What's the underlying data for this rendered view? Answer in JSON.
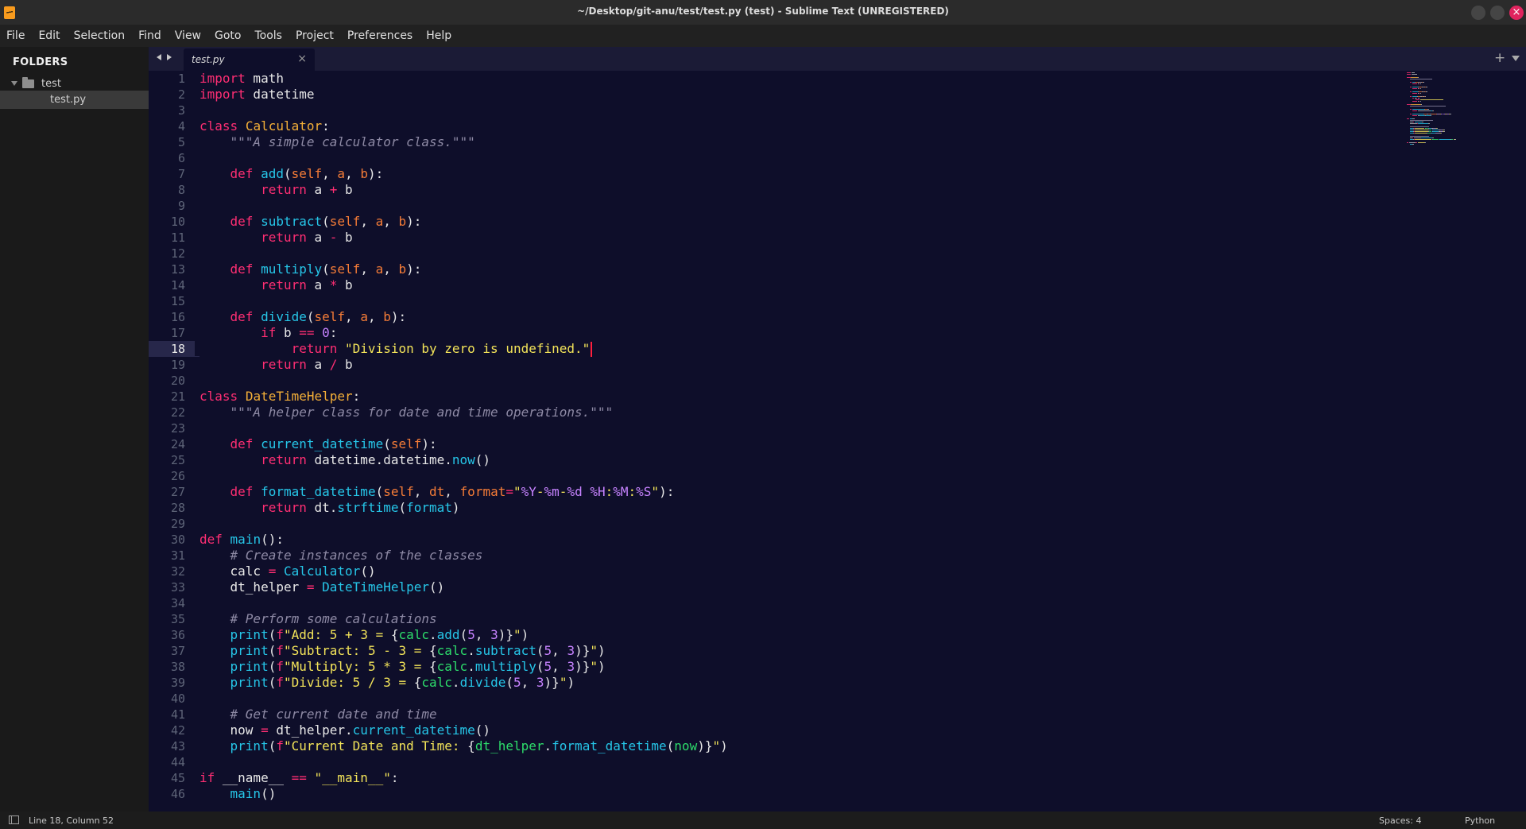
{
  "window": {
    "title": "~/Desktop/git-anu/test/test.py (test) - Sublime Text (UNREGISTERED)",
    "close_glyph": "×"
  },
  "menu": [
    "File",
    "Edit",
    "Selection",
    "Find",
    "View",
    "Goto",
    "Tools",
    "Project",
    "Preferences",
    "Help"
  ],
  "sidebar": {
    "header": "FOLDERS",
    "folder": "test",
    "file": "test.py"
  },
  "tabs": {
    "active_label": "test.py",
    "close_glyph": "×",
    "new_tab_glyph": "+"
  },
  "editor": {
    "line_numbers": [
      "1",
      "2",
      "3",
      "4",
      "5",
      "6",
      "7",
      "8",
      "9",
      "10",
      "11",
      "12",
      "13",
      "14",
      "15",
      "16",
      "17",
      "18",
      "19",
      "20",
      "21",
      "22",
      "23",
      "24",
      "25",
      "26",
      "27",
      "28",
      "29",
      "30",
      "31",
      "32",
      "33",
      "34",
      "35",
      "36",
      "37",
      "38",
      "39",
      "40",
      "41",
      "42",
      "43",
      "44",
      "45",
      "46"
    ],
    "current_line": 18,
    "colors": {
      "background": "#0e0e2a",
      "keyword": "#ff2e73",
      "class_name": "#f5b038",
      "function": "#26c6e8",
      "parameter": "#f57c37",
      "string": "#f2e359",
      "comment": "#8e8aa5",
      "format_spec": "#c783ff",
      "interpolated": "#2ddc6b",
      "cursor": "#ff1f3d"
    },
    "code_lines": [
      [
        [
          "k",
          "import"
        ],
        [
          "t",
          " math"
        ]
      ],
      [
        [
          "k",
          "import"
        ],
        [
          "t",
          " datetime"
        ]
      ],
      [],
      [
        [
          "k",
          "class"
        ],
        [
          "t",
          " "
        ],
        [
          "c",
          "Calculator"
        ],
        [
          "t",
          ":"
        ]
      ],
      [
        [
          "t",
          "    "
        ],
        [
          "cm",
          "\"\"\"A simple calculator class.\"\"\""
        ]
      ],
      [],
      [
        [
          "t",
          "    "
        ],
        [
          "k",
          "def"
        ],
        [
          "t",
          " "
        ],
        [
          "f",
          "add"
        ],
        [
          "t",
          "("
        ],
        [
          "p",
          "self"
        ],
        [
          "t",
          ", "
        ],
        [
          "p",
          "a"
        ],
        [
          "t",
          ", "
        ],
        [
          "p",
          "b"
        ],
        [
          "t",
          "):"
        ]
      ],
      [
        [
          "t",
          "        "
        ],
        [
          "k",
          "return"
        ],
        [
          "t",
          " a "
        ],
        [
          "o",
          "+"
        ],
        [
          "t",
          " b"
        ]
      ],
      [],
      [
        [
          "t",
          "    "
        ],
        [
          "k",
          "def"
        ],
        [
          "t",
          " "
        ],
        [
          "f",
          "subtract"
        ],
        [
          "t",
          "("
        ],
        [
          "p",
          "self"
        ],
        [
          "t",
          ", "
        ],
        [
          "p",
          "a"
        ],
        [
          "t",
          ", "
        ],
        [
          "p",
          "b"
        ],
        [
          "t",
          "):"
        ]
      ],
      [
        [
          "t",
          "        "
        ],
        [
          "k",
          "return"
        ],
        [
          "t",
          " a "
        ],
        [
          "o",
          "-"
        ],
        [
          "t",
          " b"
        ]
      ],
      [],
      [
        [
          "t",
          "    "
        ],
        [
          "k",
          "def"
        ],
        [
          "t",
          " "
        ],
        [
          "f",
          "multiply"
        ],
        [
          "t",
          "("
        ],
        [
          "p",
          "self"
        ],
        [
          "t",
          ", "
        ],
        [
          "p",
          "a"
        ],
        [
          "t",
          ", "
        ],
        [
          "p",
          "b"
        ],
        [
          "t",
          "):"
        ]
      ],
      [
        [
          "t",
          "        "
        ],
        [
          "k",
          "return"
        ],
        [
          "t",
          " a "
        ],
        [
          "o",
          "*"
        ],
        [
          "t",
          " b"
        ]
      ],
      [],
      [
        [
          "t",
          "    "
        ],
        [
          "k",
          "def"
        ],
        [
          "t",
          " "
        ],
        [
          "f",
          "divide"
        ],
        [
          "t",
          "("
        ],
        [
          "p",
          "self"
        ],
        [
          "t",
          ", "
        ],
        [
          "p",
          "a"
        ],
        [
          "t",
          ", "
        ],
        [
          "p",
          "b"
        ],
        [
          "t",
          "):"
        ]
      ],
      [
        [
          "t",
          "        "
        ],
        [
          "k",
          "if"
        ],
        [
          "t",
          " b "
        ],
        [
          "o",
          "=="
        ],
        [
          "t",
          " "
        ],
        [
          "n",
          "0"
        ],
        [
          "t",
          ":"
        ]
      ],
      [
        [
          "t",
          "            "
        ],
        [
          "k",
          "return"
        ],
        [
          "t",
          " "
        ],
        [
          "s",
          "\"Division by zero is undefined.\""
        ],
        [
          "cursor",
          ""
        ]
      ],
      [
        [
          "t",
          "        "
        ],
        [
          "k",
          "return"
        ],
        [
          "t",
          " a "
        ],
        [
          "o",
          "/"
        ],
        [
          "t",
          " b"
        ]
      ],
      [],
      [
        [
          "k",
          "class"
        ],
        [
          "t",
          " "
        ],
        [
          "c",
          "DateTimeHelper"
        ],
        [
          "t",
          ":"
        ]
      ],
      [
        [
          "t",
          "    "
        ],
        [
          "cm",
          "\"\"\"A helper class for date and time operations.\"\"\""
        ]
      ],
      [],
      [
        [
          "t",
          "    "
        ],
        [
          "k",
          "def"
        ],
        [
          "t",
          " "
        ],
        [
          "f",
          "current_datetime"
        ],
        [
          "t",
          "("
        ],
        [
          "p",
          "self"
        ],
        [
          "t",
          "):"
        ]
      ],
      [
        [
          "t",
          "        "
        ],
        [
          "k",
          "return"
        ],
        [
          "t",
          " datetime.datetime."
        ],
        [
          "f",
          "now"
        ],
        [
          "t",
          "()"
        ]
      ],
      [],
      [
        [
          "t",
          "    "
        ],
        [
          "k",
          "def"
        ],
        [
          "t",
          " "
        ],
        [
          "f",
          "format_datetime"
        ],
        [
          "t",
          "("
        ],
        [
          "p",
          "self"
        ],
        [
          "t",
          ", "
        ],
        [
          "p",
          "dt"
        ],
        [
          "t",
          ", "
        ],
        [
          "p",
          "format"
        ],
        [
          "o",
          "="
        ],
        [
          "s",
          "\""
        ],
        [
          "n",
          "%Y"
        ],
        [
          "s",
          "-"
        ],
        [
          "n",
          "%m"
        ],
        [
          "s",
          "-"
        ],
        [
          "n",
          "%d"
        ],
        [
          "s",
          " "
        ],
        [
          "n",
          "%H"
        ],
        [
          "s",
          ":"
        ],
        [
          "n",
          "%M"
        ],
        [
          "s",
          ":"
        ],
        [
          "n",
          "%S"
        ],
        [
          "s",
          "\""
        ],
        [
          "t",
          "):"
        ]
      ],
      [
        [
          "t",
          "        "
        ],
        [
          "k",
          "return"
        ],
        [
          "t",
          " dt."
        ],
        [
          "f",
          "strftime"
        ],
        [
          "t",
          "("
        ],
        [
          "f",
          "format"
        ],
        [
          "t",
          ")"
        ]
      ],
      [],
      [
        [
          "k",
          "def"
        ],
        [
          "t",
          " "
        ],
        [
          "f",
          "main"
        ],
        [
          "t",
          "():"
        ]
      ],
      [
        [
          "t",
          "    "
        ],
        [
          "cm",
          "# Create instances of the classes"
        ]
      ],
      [
        [
          "t",
          "    calc "
        ],
        [
          "o",
          "="
        ],
        [
          "t",
          " "
        ],
        [
          "f",
          "Calculator"
        ],
        [
          "t",
          "()"
        ]
      ],
      [
        [
          "t",
          "    dt_helper "
        ],
        [
          "o",
          "="
        ],
        [
          "t",
          " "
        ],
        [
          "f",
          "DateTimeHelper"
        ],
        [
          "t",
          "()"
        ]
      ],
      [],
      [
        [
          "t",
          "    "
        ],
        [
          "cm",
          "# Perform some calculations"
        ]
      ],
      [
        [
          "t",
          "    "
        ],
        [
          "f",
          "print"
        ],
        [
          "t",
          "("
        ],
        [
          "k",
          "f"
        ],
        [
          "s",
          "\"Add: 5 + 3 = "
        ],
        [
          "t",
          "{"
        ],
        [
          "v",
          "calc"
        ],
        [
          "t",
          "."
        ],
        [
          "f",
          "add"
        ],
        [
          "t",
          "("
        ],
        [
          "n",
          "5"
        ],
        [
          "t",
          ", "
        ],
        [
          "n",
          "3"
        ],
        [
          "t",
          ")}"
        ],
        [
          "s",
          "\""
        ],
        [
          "t",
          ")"
        ]
      ],
      [
        [
          "t",
          "    "
        ],
        [
          "f",
          "print"
        ],
        [
          "t",
          "("
        ],
        [
          "k",
          "f"
        ],
        [
          "s",
          "\"Subtract: 5 - 3 = "
        ],
        [
          "t",
          "{"
        ],
        [
          "v",
          "calc"
        ],
        [
          "t",
          "."
        ],
        [
          "f",
          "subtract"
        ],
        [
          "t",
          "("
        ],
        [
          "n",
          "5"
        ],
        [
          "t",
          ", "
        ],
        [
          "n",
          "3"
        ],
        [
          "t",
          ")}"
        ],
        [
          "s",
          "\""
        ],
        [
          "t",
          ")"
        ]
      ],
      [
        [
          "t",
          "    "
        ],
        [
          "f",
          "print"
        ],
        [
          "t",
          "("
        ],
        [
          "k",
          "f"
        ],
        [
          "s",
          "\"Multiply: 5 * 3 = "
        ],
        [
          "t",
          "{"
        ],
        [
          "v",
          "calc"
        ],
        [
          "t",
          "."
        ],
        [
          "f",
          "multiply"
        ],
        [
          "t",
          "("
        ],
        [
          "n",
          "5"
        ],
        [
          "t",
          ", "
        ],
        [
          "n",
          "3"
        ],
        [
          "t",
          ")}"
        ],
        [
          "s",
          "\""
        ],
        [
          "t",
          ")"
        ]
      ],
      [
        [
          "t",
          "    "
        ],
        [
          "f",
          "print"
        ],
        [
          "t",
          "("
        ],
        [
          "k",
          "f"
        ],
        [
          "s",
          "\"Divide: 5 / 3 = "
        ],
        [
          "t",
          "{"
        ],
        [
          "v",
          "calc"
        ],
        [
          "t",
          "."
        ],
        [
          "f",
          "divide"
        ],
        [
          "t",
          "("
        ],
        [
          "n",
          "5"
        ],
        [
          "t",
          ", "
        ],
        [
          "n",
          "3"
        ],
        [
          "t",
          ")}"
        ],
        [
          "s",
          "\""
        ],
        [
          "t",
          ")"
        ]
      ],
      [],
      [
        [
          "t",
          "    "
        ],
        [
          "cm",
          "# Get current date and time"
        ]
      ],
      [
        [
          "t",
          "    now "
        ],
        [
          "o",
          "="
        ],
        [
          "t",
          " dt_helper."
        ],
        [
          "f",
          "current_datetime"
        ],
        [
          "t",
          "()"
        ]
      ],
      [
        [
          "t",
          "    "
        ],
        [
          "f",
          "print"
        ],
        [
          "t",
          "("
        ],
        [
          "k",
          "f"
        ],
        [
          "s",
          "\"Current Date and Time: "
        ],
        [
          "t",
          "{"
        ],
        [
          "v",
          "dt_helper"
        ],
        [
          "t",
          "."
        ],
        [
          "f",
          "format_datetime"
        ],
        [
          "t",
          "("
        ],
        [
          "v",
          "now"
        ],
        [
          "t",
          ")}"
        ],
        [
          "s",
          "\""
        ],
        [
          "t",
          ")"
        ]
      ],
      [],
      [
        [
          "k",
          "if"
        ],
        [
          "t",
          " __name__ "
        ],
        [
          "o",
          "=="
        ],
        [
          "t",
          " "
        ],
        [
          "s",
          "\"__main__\""
        ],
        [
          "t",
          ":"
        ]
      ],
      [
        [
          "t",
          "    "
        ],
        [
          "f",
          "main"
        ],
        [
          "t",
          "()"
        ]
      ]
    ]
  },
  "status": {
    "position": "Line 18, Column 52",
    "indentation": "Spaces: 4",
    "syntax": "Python"
  }
}
